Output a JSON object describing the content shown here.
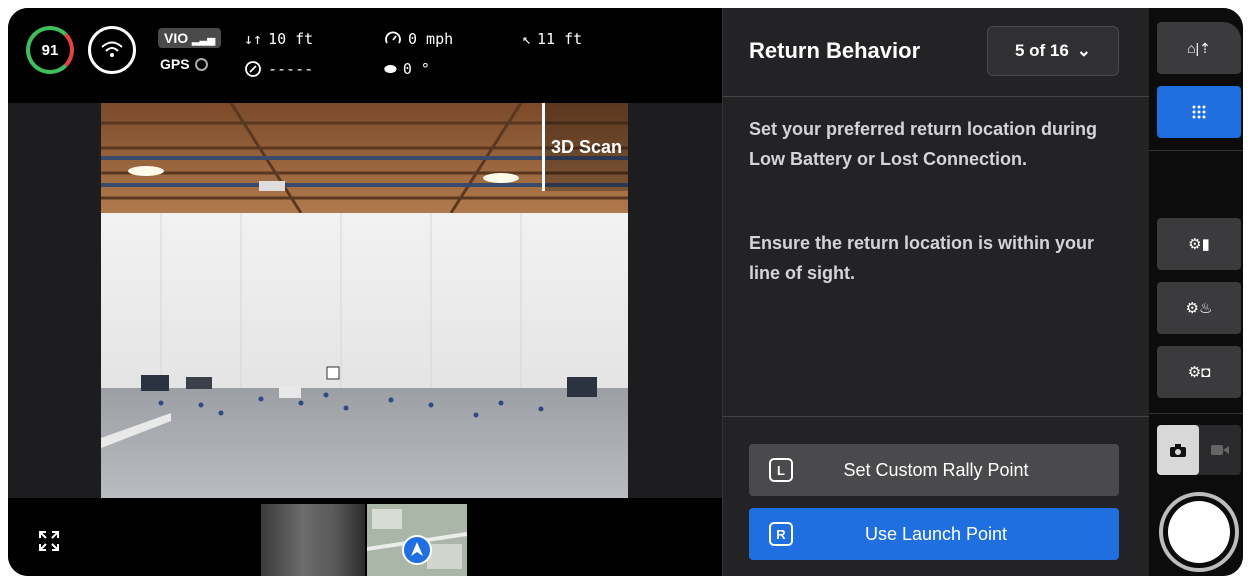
{
  "hud": {
    "battery": "91",
    "vio": "VIO",
    "gps": "GPS",
    "altitude": "10 ft",
    "speed": "0 mph",
    "distance": "11 ft",
    "heading": "-----",
    "gimbal": "0 °"
  },
  "view": {
    "mode_label": "3D Scan"
  },
  "panel": {
    "title": "Return Behavior",
    "pager": "5 of 16",
    "paragraph1": "Set your preferred return location during Low Battery or Lost Connection.",
    "paragraph2": "Ensure the return location is within your line of sight.",
    "buttons": [
      {
        "key": "L",
        "label": "Set Custom Rally Point"
      },
      {
        "key": "R",
        "label": "Use Launch Point"
      }
    ]
  },
  "rail": {
    "icons": [
      "home-return-icon",
      "grid-icon",
      "scan-settings-icon",
      "fire-settings-icon",
      "camera-settings-icon",
      "photo-mode-icon",
      "video-mode-icon",
      "shutter-button"
    ]
  },
  "colors": {
    "accent": "#1f6fe0",
    "battery_ok": "#3fbf5b",
    "battery_warn": "#e0443c"
  }
}
